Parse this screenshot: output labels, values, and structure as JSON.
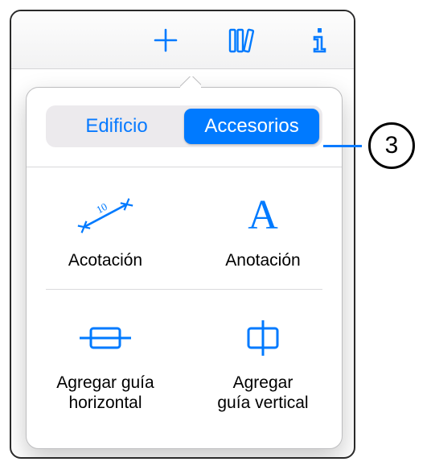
{
  "toolbar": {
    "add_icon": "plus-icon",
    "library_icon": "books-icon",
    "info_icon": "info-icon"
  },
  "popover": {
    "segmented": {
      "inactive": "Edificio",
      "active": "Accesorios"
    },
    "items": [
      {
        "label": "Acotación"
      },
      {
        "label": "Anotación"
      },
      {
        "label": "Agregar guía\nhorizontal"
      },
      {
        "label": "Agregar\nguía vertical"
      }
    ]
  },
  "callout": {
    "number": "3"
  },
  "colors": {
    "accent": "#007aff"
  }
}
